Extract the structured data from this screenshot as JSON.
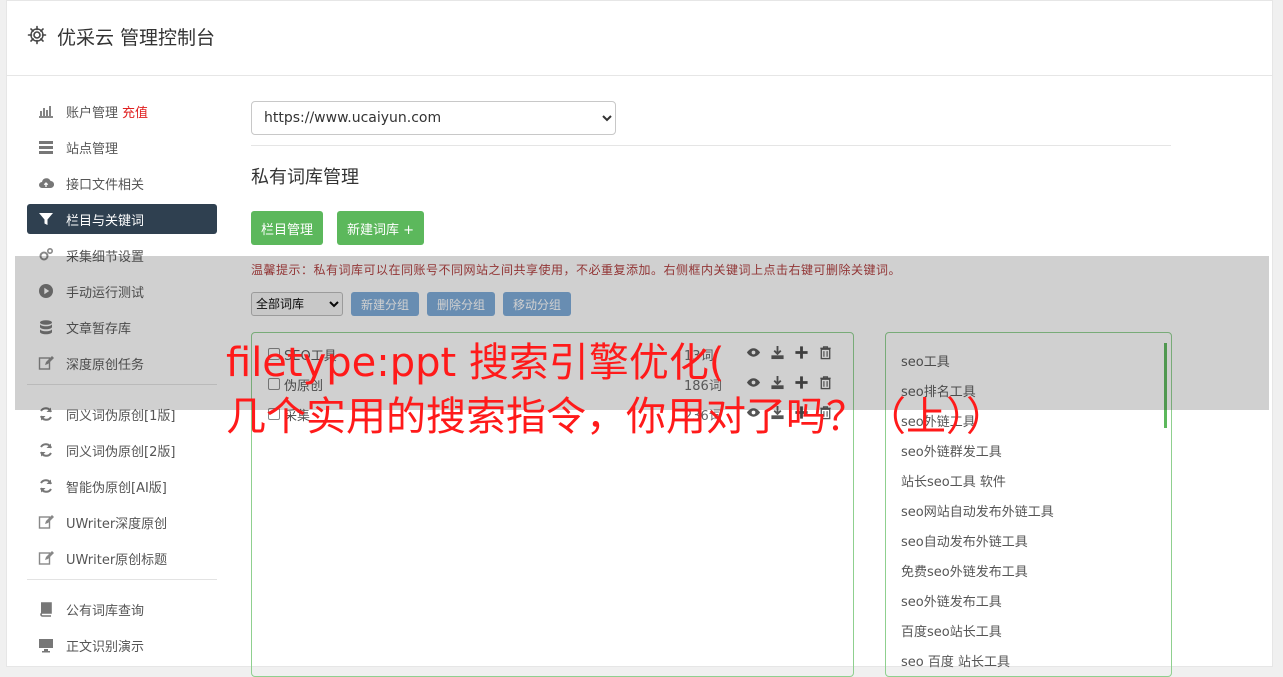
{
  "header": {
    "title": "优采云 管理控制台",
    "icon": "gear-icon"
  },
  "sidebar": {
    "group1": [
      {
        "label": "账户管理",
        "badge": "充值",
        "icon": "bar-chart-icon"
      },
      {
        "label": "站点管理",
        "icon": "server-icon"
      },
      {
        "label": "接口文件相关",
        "icon": "cloud-upload-icon"
      },
      {
        "label": "栏目与关键词",
        "icon": "filter-icon",
        "active": true
      },
      {
        "label": "采集细节设置",
        "icon": "cogs-icon"
      },
      {
        "label": "手动运行测试",
        "icon": "play-circle-icon"
      },
      {
        "label": "文章暂存库",
        "icon": "database-icon"
      },
      {
        "label": "深度原创任务",
        "icon": "edit-icon"
      }
    ],
    "group2": [
      {
        "label": "同义词伪原创[1版]",
        "icon": "refresh-icon"
      },
      {
        "label": "同义词伪原创[2版]",
        "icon": "refresh-icon"
      },
      {
        "label": "智能伪原创[AI版]",
        "icon": "refresh-icon"
      },
      {
        "label": "UWriter深度原创",
        "icon": "edit-icon"
      },
      {
        "label": "UWriter原创标题",
        "icon": "edit-icon"
      }
    ],
    "group3": [
      {
        "label": "公有词库查询",
        "icon": "book-icon"
      },
      {
        "label": "正文识别演示",
        "icon": "monitor-icon"
      }
    ]
  },
  "main": {
    "site_select": "https://www.ucaiyun.com",
    "section_title": "私有词库管理",
    "btn_columns": "栏目管理",
    "btn_new_lib": "新建词库 +",
    "tip": "温馨提示：私有词库可以在同账号不同网站之间共享使用，不必重复添加。右侧框内关键词上点击右键可删除关键词。",
    "filter_select": "全部词库",
    "btn_new_group": "新建分组",
    "btn_delete_group": "删除分组",
    "btn_move_group": "移动分组",
    "libraries": [
      {
        "name": "SEO工具",
        "count": "13词"
      },
      {
        "name": "伪原创",
        "count": "186词"
      },
      {
        "name": "采集",
        "count": "236词"
      }
    ],
    "keywords": [
      "seo工具",
      "seo排名工具",
      "seo外链工具",
      "seo外链群发工具",
      "站长seo工具 软件",
      "seo网站自动发布外链工具",
      "seo自动发布外链工具",
      "免费seo外链发布工具",
      "seo外链发布工具",
      "百度seo站长工具",
      "seo 百度 站长工具"
    ]
  },
  "overlay": {
    "line1": "filetype:ppt 搜索引擎优化(",
    "line2": "几个实用的搜索指令，你用对了吗？（上））"
  }
}
